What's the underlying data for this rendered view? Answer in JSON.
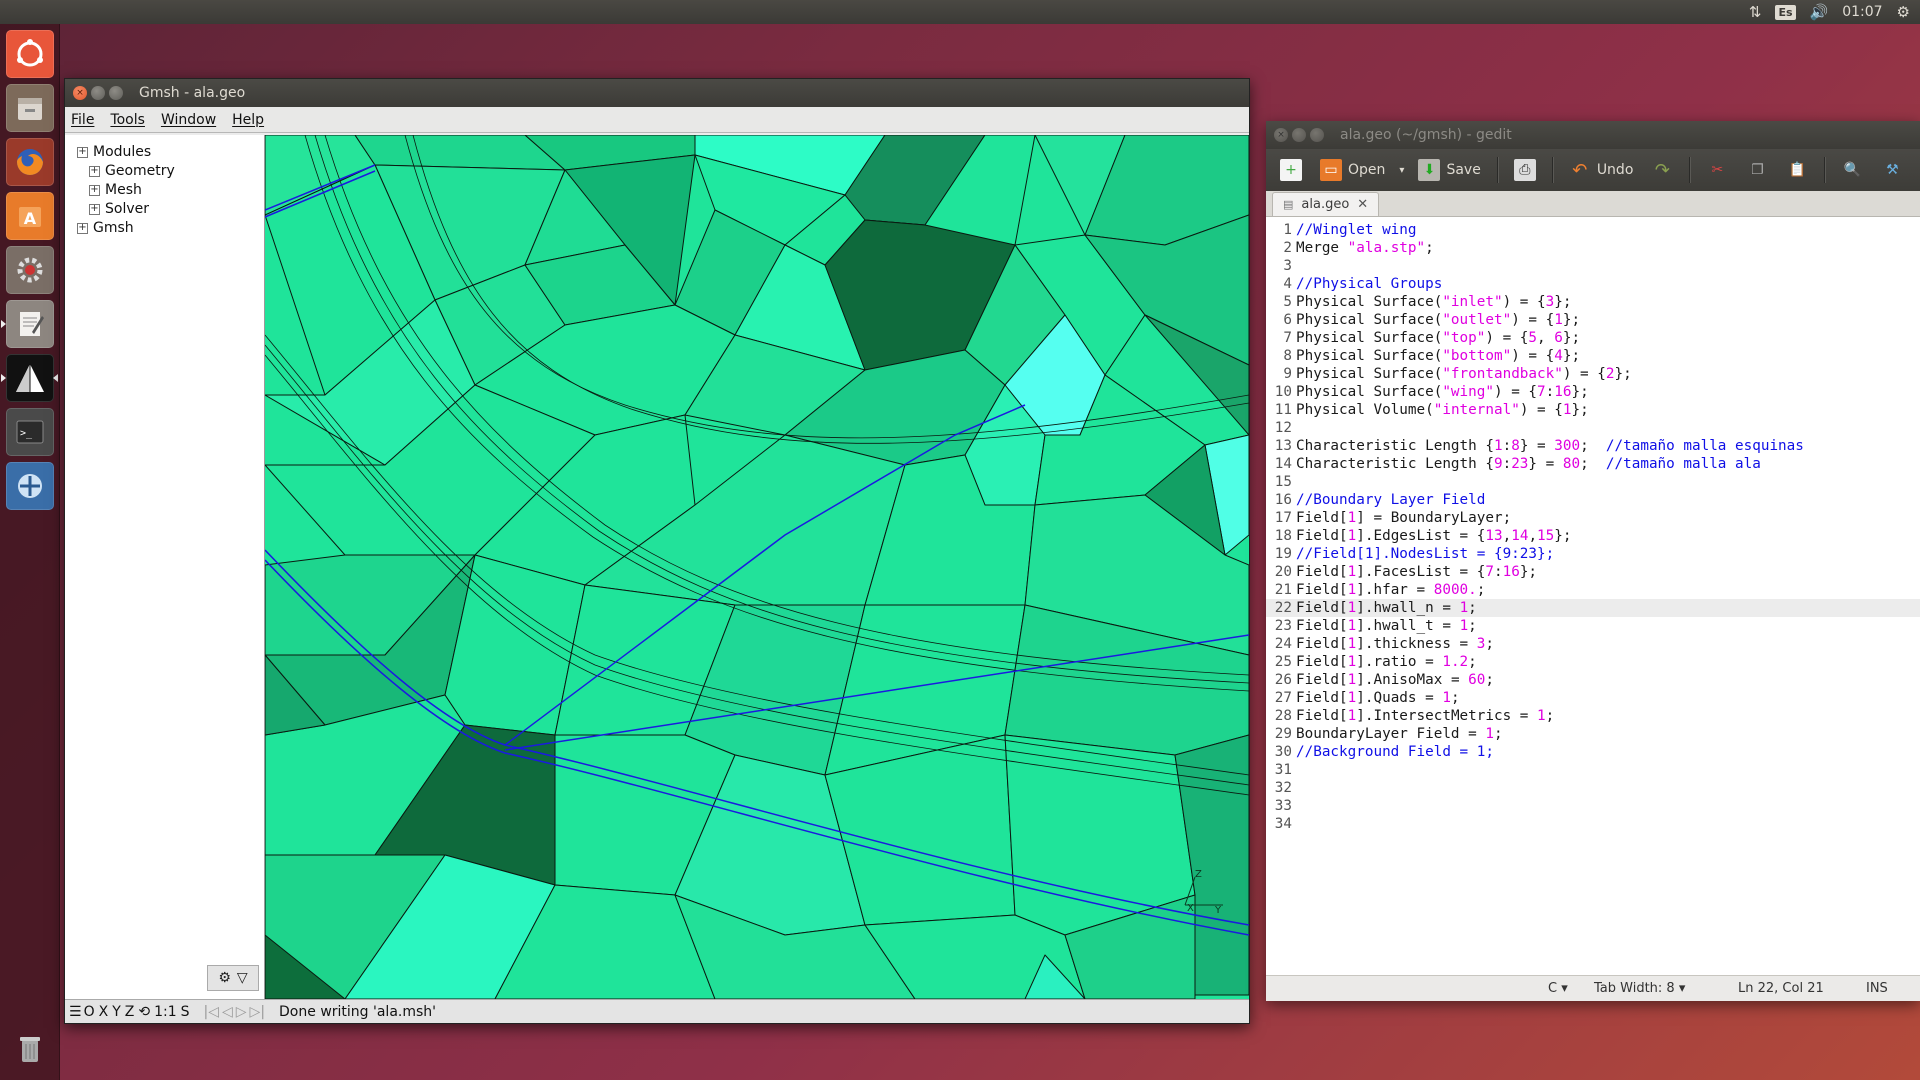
{
  "top_panel": {
    "keyboard_layout": "Es",
    "clock": "01:07"
  },
  "launcher": {
    "items": [
      "ubuntu-dash",
      "files",
      "firefox",
      "software-center",
      "system-settings",
      "text-editor",
      "gmsh",
      "terminal",
      "remote-desktop",
      "trash"
    ]
  },
  "gmsh": {
    "title": "Gmsh - ala.geo",
    "menu": [
      "File",
      "Tools",
      "Window",
      "Help"
    ],
    "tree": [
      {
        "label": "Modules",
        "level": 0,
        "expander": "+"
      },
      {
        "label": "Geometry",
        "level": 1,
        "expander": "+"
      },
      {
        "label": "Mesh",
        "level": 1,
        "expander": "+"
      },
      {
        "label": "Solver",
        "level": 1,
        "expander": "+"
      },
      {
        "label": "Gmsh",
        "level": 0,
        "expander": "+"
      }
    ],
    "status": {
      "buttons": [
        "O",
        "X",
        "Y",
        "Z",
        "1:1",
        "S"
      ],
      "message": "Done writing 'ala.msh'"
    },
    "axes": {
      "x": "X",
      "y": "Y",
      "z": "Z"
    },
    "colors": {
      "mesh_fill": "#1fe49a",
      "mesh_edge": "#0a1a10",
      "curve": "#1a1ae0"
    }
  },
  "gedit": {
    "title": "ala.geo (~/gmsh) - gedit",
    "toolbar": {
      "open": "Open",
      "save": "Save",
      "undo": "Undo"
    },
    "tab": {
      "label": "ala.geo"
    },
    "lines": [
      [
        [
          "c",
          "//Winglet wing"
        ]
      ],
      [
        [
          "t",
          "Merge "
        ],
        [
          "s",
          "\"ala.stp\""
        ],
        [
          "t",
          ";"
        ]
      ],
      [],
      [
        [
          "c",
          "//Physical Groups"
        ]
      ],
      [
        [
          "t",
          "Physical Surface("
        ],
        [
          "s",
          "\"inlet\""
        ],
        [
          "t",
          ") = {"
        ],
        [
          "n",
          "3"
        ],
        [
          "t",
          "};"
        ]
      ],
      [
        [
          "t",
          "Physical Surface("
        ],
        [
          "s",
          "\"outlet\""
        ],
        [
          "t",
          ") = {"
        ],
        [
          "n",
          "1"
        ],
        [
          "t",
          "};"
        ]
      ],
      [
        [
          "t",
          "Physical Surface("
        ],
        [
          "s",
          "\"top\""
        ],
        [
          "t",
          ") = {"
        ],
        [
          "n",
          "5"
        ],
        [
          "t",
          ", "
        ],
        [
          "n",
          "6"
        ],
        [
          "t",
          "};"
        ]
      ],
      [
        [
          "t",
          "Physical Surface("
        ],
        [
          "s",
          "\"bottom\""
        ],
        [
          "t",
          ") = {"
        ],
        [
          "n",
          "4"
        ],
        [
          "t",
          "};"
        ]
      ],
      [
        [
          "t",
          "Physical Surface("
        ],
        [
          "s",
          "\"frontandback\""
        ],
        [
          "t",
          ") = {"
        ],
        [
          "n",
          "2"
        ],
        [
          "t",
          "};"
        ]
      ],
      [
        [
          "t",
          "Physical Surface("
        ],
        [
          "s",
          "\"wing\""
        ],
        [
          "t",
          ") = {"
        ],
        [
          "n",
          "7"
        ],
        [
          "t",
          ":"
        ],
        [
          "n",
          "16"
        ],
        [
          "t",
          "};"
        ]
      ],
      [
        [
          "t",
          "Physical Volume("
        ],
        [
          "s",
          "\"internal\""
        ],
        [
          "t",
          ") = {"
        ],
        [
          "n",
          "1"
        ],
        [
          "t",
          "};"
        ]
      ],
      [],
      [
        [
          "t",
          "Characteristic Length {"
        ],
        [
          "n",
          "1"
        ],
        [
          "t",
          ":"
        ],
        [
          "n",
          "8"
        ],
        [
          "t",
          "} = "
        ],
        [
          "n",
          "300"
        ],
        [
          "t",
          ";  "
        ],
        [
          "c",
          "//tamaño malla esquinas"
        ]
      ],
      [
        [
          "t",
          "Characteristic Length {"
        ],
        [
          "n",
          "9"
        ],
        [
          "t",
          ":"
        ],
        [
          "n",
          "23"
        ],
        [
          "t",
          "} = "
        ],
        [
          "n",
          "80"
        ],
        [
          "t",
          ";  "
        ],
        [
          "c",
          "//tamaño malla ala"
        ]
      ],
      [],
      [
        [
          "c",
          "//Boundary Layer Field"
        ]
      ],
      [
        [
          "t",
          "Field["
        ],
        [
          "n",
          "1"
        ],
        [
          "t",
          "] = BoundaryLayer;"
        ]
      ],
      [
        [
          "t",
          "Field["
        ],
        [
          "n",
          "1"
        ],
        [
          "t",
          "].EdgesList = {"
        ],
        [
          "n",
          "13"
        ],
        [
          "t",
          ","
        ],
        [
          "n",
          "14"
        ],
        [
          "t",
          ","
        ],
        [
          "n",
          "15"
        ],
        [
          "t",
          "};"
        ]
      ],
      [
        [
          "c",
          "//Field[1].NodesList = {9:23};"
        ]
      ],
      [
        [
          "t",
          "Field["
        ],
        [
          "n",
          "1"
        ],
        [
          "t",
          "].FacesList = {"
        ],
        [
          "n",
          "7"
        ],
        [
          "t",
          ":"
        ],
        [
          "n",
          "16"
        ],
        [
          "t",
          "};"
        ]
      ],
      [
        [
          "t",
          "Field["
        ],
        [
          "n",
          "1"
        ],
        [
          "t",
          "].hfar = "
        ],
        [
          "n",
          "8000."
        ],
        [
          "t",
          ";"
        ]
      ],
      [
        [
          "t",
          "Field["
        ],
        [
          "n",
          "1"
        ],
        [
          "t",
          "].hwall_n = "
        ],
        [
          "n",
          "1"
        ],
        [
          "t",
          ";"
        ]
      ],
      [
        [
          "t",
          "Field["
        ],
        [
          "n",
          "1"
        ],
        [
          "t",
          "].hwall_t = "
        ],
        [
          "n",
          "1"
        ],
        [
          "t",
          ";"
        ]
      ],
      [
        [
          "t",
          "Field["
        ],
        [
          "n",
          "1"
        ],
        [
          "t",
          "].thickness = "
        ],
        [
          "n",
          "3"
        ],
        [
          "t",
          ";"
        ]
      ],
      [
        [
          "t",
          "Field["
        ],
        [
          "n",
          "1"
        ],
        [
          "t",
          "].ratio = "
        ],
        [
          "n",
          "1.2"
        ],
        [
          "t",
          ";"
        ]
      ],
      [
        [
          "t",
          "Field["
        ],
        [
          "n",
          "1"
        ],
        [
          "t",
          "].AnisoMax = "
        ],
        [
          "n",
          "60"
        ],
        [
          "t",
          ";"
        ]
      ],
      [
        [
          "t",
          "Field["
        ],
        [
          "n",
          "1"
        ],
        [
          "t",
          "].Quads = "
        ],
        [
          "n",
          "1"
        ],
        [
          "t",
          ";"
        ]
      ],
      [
        [
          "t",
          "Field["
        ],
        [
          "n",
          "1"
        ],
        [
          "t",
          "].IntersectMetrics = "
        ],
        [
          "n",
          "1"
        ],
        [
          "t",
          ";"
        ]
      ],
      [
        [
          "t",
          "BoundaryLayer Field = "
        ],
        [
          "n",
          "1"
        ],
        [
          "t",
          ";"
        ]
      ],
      [
        [
          "c",
          "//Background Field = 1;"
        ]
      ],
      [],
      [],
      [],
      []
    ],
    "current_line": 22,
    "status": {
      "language": "C ▾",
      "tab_width": "Tab Width: 8 ▾",
      "position": "Ln 22, Col 21",
      "mode": "INS"
    },
    "colors": {
      "comment": "#1010e6",
      "string": "#e000e0",
      "number": "#e000e0"
    }
  }
}
